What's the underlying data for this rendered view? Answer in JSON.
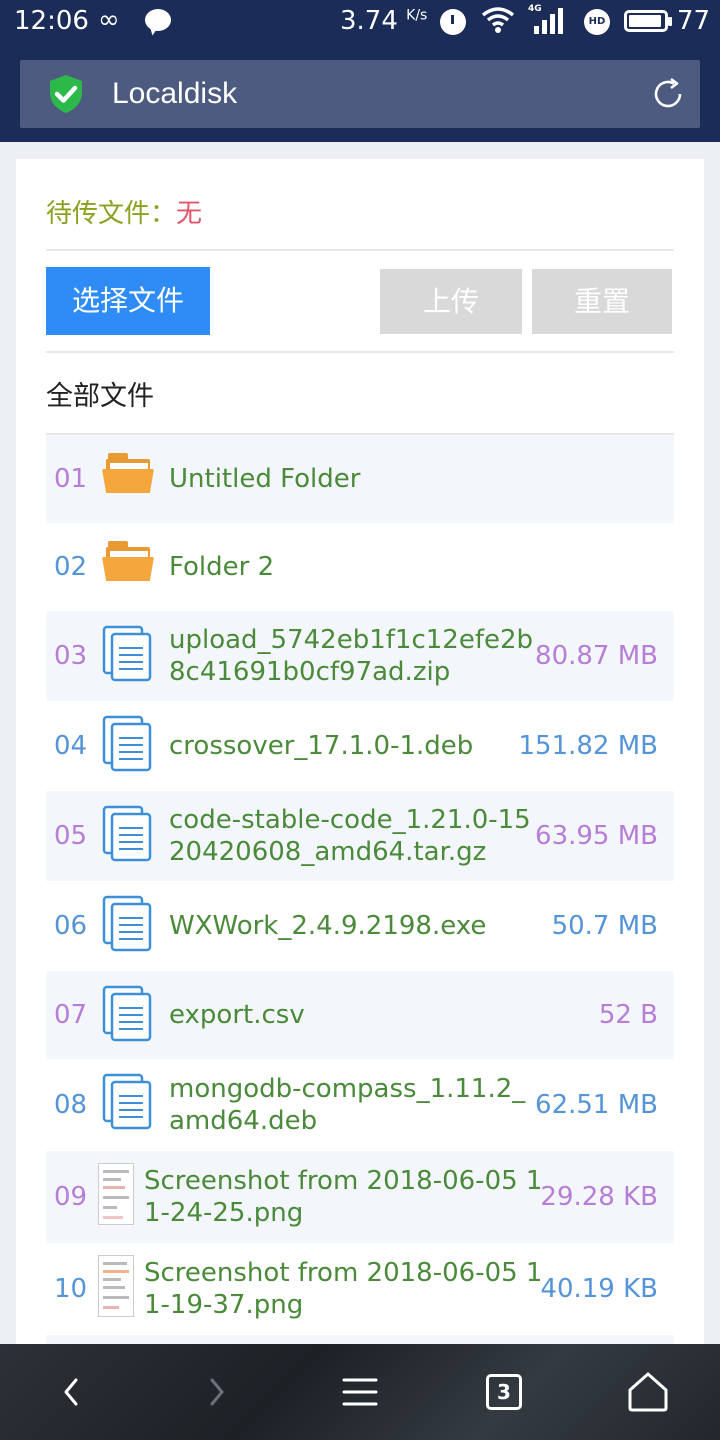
{
  "status_bar": {
    "time": "12:06",
    "loop_icon": "∞",
    "speed": "3.74",
    "speed_unit": "K/s",
    "network": "4G",
    "hd_badge": "HD",
    "battery": "77"
  },
  "header": {
    "title": "Localdisk",
    "shield_icon": "shield-check-icon",
    "refresh_icon": "refresh-icon",
    "bg_color": "#1a2c57",
    "shield_color": "#2db84a"
  },
  "upload": {
    "pending_label": "待传文件：",
    "pending_value": "无",
    "select_button": "选择文件",
    "upload_button": "上传",
    "reset_button": "重置",
    "select_color": "#2f8cf6"
  },
  "files": {
    "heading": "全部文件",
    "items": [
      {
        "index": "01",
        "type": "folder",
        "name": "Untitled Folder",
        "size": ""
      },
      {
        "index": "02",
        "type": "folder",
        "name": "Folder 2",
        "size": ""
      },
      {
        "index": "03",
        "type": "document",
        "name": "upload_5742eb1f1c12efe2b8c41691b0cf97ad.zip",
        "size": "80.87 MB"
      },
      {
        "index": "04",
        "type": "document",
        "name": "crossover_17.1.0-1.deb",
        "size": "151.82 MB"
      },
      {
        "index": "05",
        "type": "document",
        "name": "code-stable-code_1.21.0-1520420608_amd64.tar.gz",
        "size": "63.95 MB"
      },
      {
        "index": "06",
        "type": "document",
        "name": "WXWork_2.4.9.2198.exe",
        "size": "50.7 MB"
      },
      {
        "index": "07",
        "type": "document",
        "name": "export.csv",
        "size": "52 B"
      },
      {
        "index": "08",
        "type": "document",
        "name": "mongodb-compass_1.11.2_amd64.deb",
        "size": "62.51 MB"
      },
      {
        "index": "09",
        "type": "image",
        "name": "Screenshot from 2018-06-05 11-24-25.png",
        "size": "29.28 KB"
      },
      {
        "index": "10",
        "type": "image",
        "name": "Screenshot from 2018-06-05 11-19-37.png",
        "size": "40.19 KB"
      }
    ]
  },
  "bottom_nav": {
    "back_icon": "back-icon",
    "forward_icon": "forward-icon",
    "menu_icon": "menu-icon",
    "tabs_count": "3",
    "home_icon": "home-icon"
  }
}
